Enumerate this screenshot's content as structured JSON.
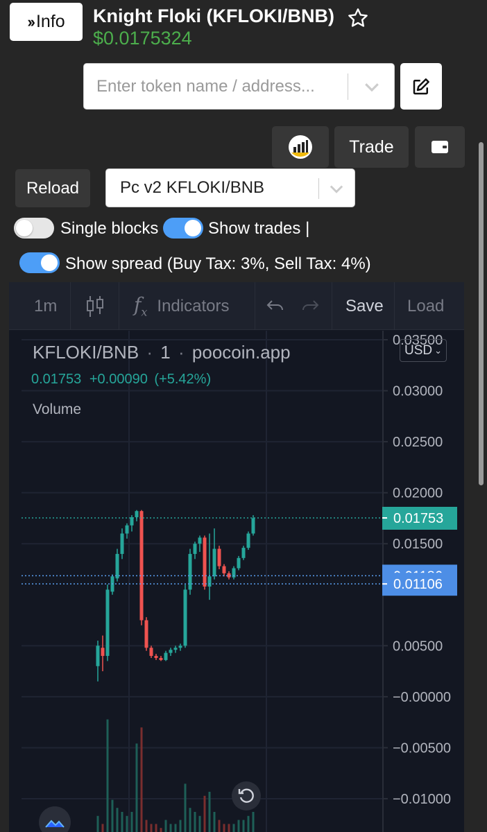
{
  "header": {
    "info_label": "Info",
    "title": "Knight Floki (KFLOKI/BNB)",
    "price": "$0.0175324"
  },
  "search": {
    "placeholder": "Enter token name / address..."
  },
  "buttons": {
    "trade_label": "Trade",
    "reload_label": "Reload"
  },
  "pair_select": {
    "selected": "Pc v2 KFLOKI/BNB"
  },
  "toggles": {
    "single_blocks": {
      "label": "Single blocks",
      "on": false
    },
    "show_trades": {
      "label": "Show trades |",
      "on": true
    },
    "show_spread": {
      "label": "Show spread (Buy Tax: 3%, Sell Tax: 4%)",
      "on": true
    }
  },
  "chart": {
    "toolbar": {
      "interval": "1m",
      "indicators": "Indicators",
      "save": "Save",
      "load": "Load"
    },
    "legend": {
      "symbol": "KFLOKI/BNB",
      "sep1": "·",
      "interval": "1",
      "sep2": "·",
      "source": "poocoin.app",
      "last": "0.01753",
      "change": "+0.00090",
      "change_pct": "(+5.42%)",
      "volume_label": "Volume"
    },
    "currency": "USD",
    "colors": {
      "up": "#26a69a",
      "down": "#ef5350",
      "background": "#131722",
      "spread_tag": "#4d8ee6"
    }
  },
  "chart_data": {
    "type": "candlestick",
    "y_ticks": [
      "0.03500",
      "0.03000",
      "0.02500",
      "0.02000",
      "0.01500",
      "0.00500",
      "−0.00000",
      "−0.00500",
      "−0.01000"
    ],
    "price_tags": [
      {
        "label": "0.01753",
        "value": 0.01753,
        "kind": "last"
      },
      {
        "label": "0.01186",
        "value": 0.01186,
        "kind": "buy-spread"
      },
      {
        "label": "0.01106",
        "value": 0.01106,
        "kind": "sell-spread"
      }
    ],
    "candles": [
      {
        "o": 0.003,
        "h": 0.0055,
        "l": 0.0015,
        "c": 0.005
      },
      {
        "o": 0.0048,
        "h": 0.006,
        "l": 0.0025,
        "c": 0.004
      },
      {
        "o": 0.004,
        "h": 0.011,
        "l": 0.0035,
        "c": 0.0105
      },
      {
        "o": 0.0103,
        "h": 0.012,
        "l": 0.01,
        "c": 0.0118
      },
      {
        "o": 0.0116,
        "h": 0.0145,
        "l": 0.0113,
        "c": 0.014
      },
      {
        "o": 0.014,
        "h": 0.0165,
        "l": 0.0135,
        "c": 0.016
      },
      {
        "o": 0.016,
        "h": 0.017,
        "l": 0.0155,
        "c": 0.0168
      },
      {
        "o": 0.0168,
        "h": 0.0178,
        "l": 0.0162,
        "c": 0.0176
      },
      {
        "o": 0.0176,
        "h": 0.0183,
        "l": 0.0172,
        "c": 0.0182
      },
      {
        "o": 0.0182,
        "h": 0.0183,
        "l": 0.007,
        "c": 0.0075
      },
      {
        "o": 0.0075,
        "h": 0.0078,
        "l": 0.0045,
        "c": 0.0048
      },
      {
        "o": 0.0048,
        "h": 0.005,
        "l": 0.0038,
        "c": 0.004
      },
      {
        "o": 0.004,
        "h": 0.0042,
        "l": 0.0036,
        "c": 0.0038
      },
      {
        "o": 0.0038,
        "h": 0.004,
        "l": 0.0035,
        "c": 0.0036
      },
      {
        "o": 0.0036,
        "h": 0.0045,
        "l": 0.0035,
        "c": 0.0043
      },
      {
        "o": 0.0043,
        "h": 0.0048,
        "l": 0.004,
        "c": 0.0046
      },
      {
        "o": 0.0046,
        "h": 0.005,
        "l": 0.0043,
        "c": 0.0048
      },
      {
        "o": 0.0048,
        "h": 0.0052,
        "l": 0.0045,
        "c": 0.005
      },
      {
        "o": 0.005,
        "h": 0.011,
        "l": 0.0048,
        "c": 0.0105
      },
      {
        "o": 0.0105,
        "h": 0.0145,
        "l": 0.01,
        "c": 0.014
      },
      {
        "o": 0.014,
        "h": 0.0152,
        "l": 0.0135,
        "c": 0.015
      },
      {
        "o": 0.015,
        "h": 0.0158,
        "l": 0.0142,
        "c": 0.0156
      },
      {
        "o": 0.0156,
        "h": 0.0158,
        "l": 0.0105,
        "c": 0.0108
      },
      {
        "o": 0.0108,
        "h": 0.016,
        "l": 0.0095,
        "c": 0.0118
      },
      {
        "o": 0.0118,
        "h": 0.0165,
        "l": 0.0115,
        "c": 0.0145
      },
      {
        "o": 0.0145,
        "h": 0.0148,
        "l": 0.0125,
        "c": 0.0128
      },
      {
        "o": 0.0128,
        "h": 0.013,
        "l": 0.0118,
        "c": 0.0121
      },
      {
        "o": 0.0121,
        "h": 0.0123,
        "l": 0.0115,
        "c": 0.0117
      },
      {
        "o": 0.0117,
        "h": 0.0128,
        "l": 0.0115,
        "c": 0.0126
      },
      {
        "o": 0.0126,
        "h": 0.0138,
        "l": 0.0124,
        "c": 0.0136
      },
      {
        "o": 0.0136,
        "h": 0.0148,
        "l": 0.0134,
        "c": 0.0146
      },
      {
        "o": 0.0146,
        "h": 0.0162,
        "l": 0.0144,
        "c": 0.016
      },
      {
        "o": 0.016,
        "h": 0.0178,
        "l": 0.0158,
        "c": 0.0175
      }
    ],
    "volumes": [
      0.04,
      0.02,
      0.28,
      0.08,
      0.06,
      0.05,
      0.04,
      0.05,
      0.22,
      0.26,
      0.03,
      0.02,
      0.02,
      0.01,
      0.03,
      0.02,
      0.02,
      0.03,
      0.12,
      0.06,
      0.05,
      0.04,
      0.09,
      0.1,
      0.05,
      0.03,
      0.02,
      0.02,
      0.02,
      0.03,
      0.03,
      0.04,
      0.05
    ],
    "ylim": [
      -0.0115,
      0.0358
    ]
  }
}
